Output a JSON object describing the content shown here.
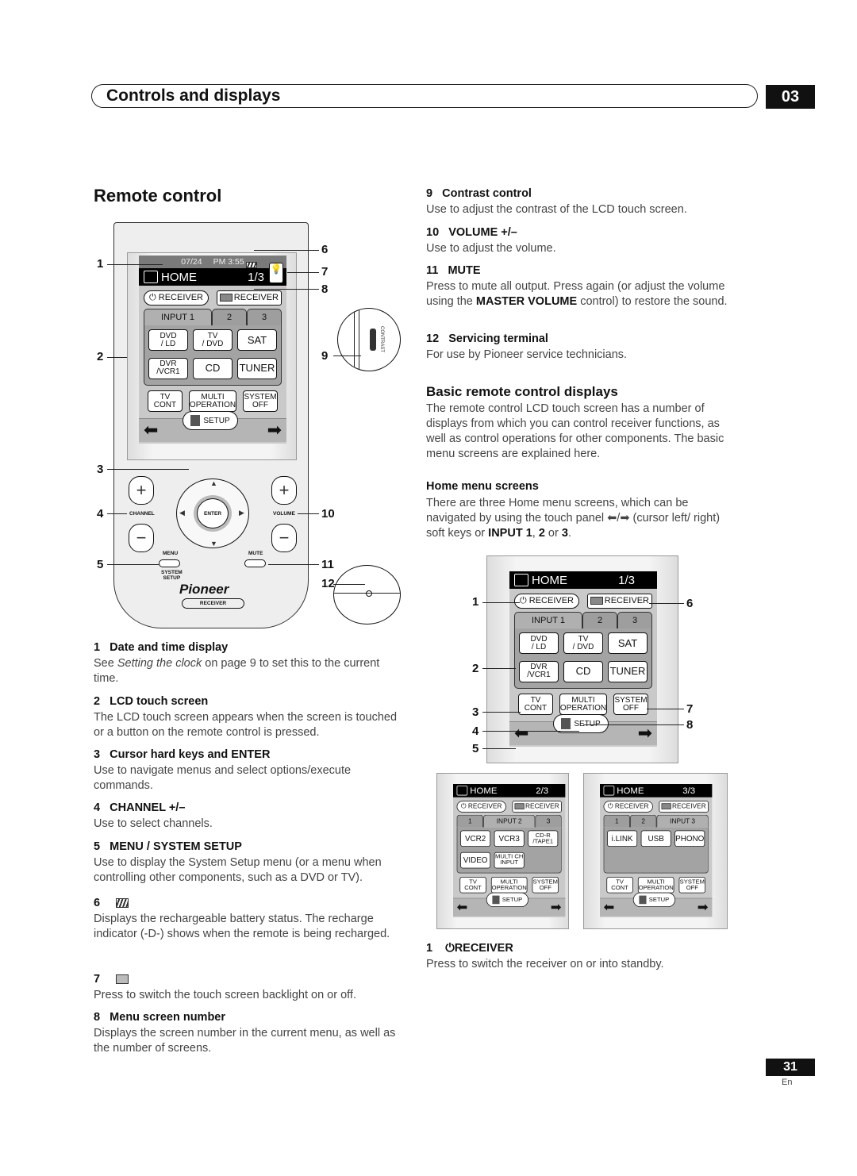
{
  "header": {
    "title": "Controls and displays",
    "chapter": "03"
  },
  "section_title": "Remote control",
  "remote": {
    "callouts": [
      "1",
      "2",
      "3",
      "4",
      "5",
      "6",
      "7",
      "8",
      "9",
      "10",
      "11",
      "12"
    ],
    "screen": {
      "date": "07/24",
      "time": "PM 3:55",
      "title": "HOME",
      "page": "1/3",
      "power": "RECEIVER",
      "av": "RECEIVER",
      "tabs": [
        {
          "label": "INPUT  1",
          "active": true
        },
        {
          "label": "2"
        },
        {
          "label": "3"
        }
      ],
      "sources": [
        "DVD\n/ LD",
        "TV\n/ DVD",
        "SAT",
        "DVR\n/VCR1",
        "CD",
        "TUNER"
      ],
      "bottom": [
        "TV\nCONT",
        "MULTI\nOPERATION",
        "SYSTEM\nOFF"
      ],
      "setup": "SETUP"
    },
    "contrast_label": "CONTRAST",
    "channel": "CHANNEL",
    "volume": "VOLUME",
    "enter": "ENTER",
    "menu": "MENU",
    "mute": "MUTE",
    "system_setup": "SYSTEM\nSETUP",
    "brand": "Pioneer",
    "model": "RECEIVER",
    "plus": "+",
    "minus": "−"
  },
  "left_items": [
    {
      "n": "1",
      "title": "Date and time display",
      "body_pre": "See ",
      "body_em": "Setting the clock",
      "body_post": " on page 9 to set this to the current time."
    },
    {
      "n": "2",
      "title": "LCD touch screen",
      "body": "The LCD touch screen appears when the screen is touched or a button on the remote control is pressed."
    },
    {
      "n": "3",
      "title": "Cursor hard keys and ENTER",
      "body": "Use to navigate menus and select options/execute commands."
    },
    {
      "n": "4",
      "title": "CHANNEL  +/–",
      "body": "Use to select channels."
    },
    {
      "n": "5",
      "title": "MENU / SYSTEM SETUP",
      "body": "Use to display the System Setup menu (or a menu when controlling other components, such as a DVD or TV)."
    },
    {
      "n": "6",
      "icon": "battery-icon",
      "body_pre": "Displays the rechargeable battery status. The recharge indicator (",
      "body_post": ") shows when the remote is being recharged."
    },
    {
      "n": "7",
      "icon": "backlight-bulb-icon",
      "body": "Press to switch the touch screen backlight on or off."
    },
    {
      "n": "8",
      "title": "Menu screen number",
      "body": "Displays the screen number in the current menu, as well as the number of screens."
    }
  ],
  "right_items": [
    {
      "n": "9",
      "title": "Contrast control",
      "body": "Use to adjust the contrast of the LCD touch screen."
    },
    {
      "n": "10",
      "title": "VOLUME +/–",
      "body": "Use to adjust the volume."
    },
    {
      "n": "11",
      "title": "MUTE",
      "body_pre": "Press to mute all output. Press again (or adjust the volume using the ",
      "body_b": "MASTER VOLUME",
      "body_post": " control) to restore the sound."
    },
    {
      "n": "12",
      "title": "Servicing terminal",
      "body": "For use by Pioneer service technicians."
    }
  ],
  "basic": {
    "title": "Basic remote control displays",
    "body": "The remote control LCD touch screen has a number of displays from which you can control receiver functions, as well as control operations for other components. The basic menu screens are explained here."
  },
  "home_menu": {
    "title": "Home menu screens",
    "body_pre": "There are three Home menu screens, which can be navigated by using the touch panel ",
    "body_mid": " (cursor left/ right) soft keys or ",
    "b1": "INPUT 1",
    "c1": ", ",
    "b2": "2",
    "c2": " or ",
    "b3": "3",
    "end": "."
  },
  "screens": [
    {
      "title": "HOME",
      "page": "1/3",
      "power": "RECEIVER",
      "av": "RECEIVER",
      "tabs": [
        {
          "label": "INPUT  1",
          "active": true
        },
        {
          "label": "2"
        },
        {
          "label": "3"
        }
      ],
      "sources": [
        "DVD\n/ LD",
        "TV\n/ DVD",
        "SAT",
        "DVR\n/VCR1",
        "CD",
        "TUNER"
      ],
      "bottom": [
        "TV\nCONT",
        "MULTI\nOPERATION",
        "SYSTEM\nOFF"
      ],
      "setup": "SETUP"
    },
    {
      "title": "HOME",
      "page": "2/3",
      "power": "RECEIVER",
      "av": "RECEIVER",
      "tabs": [
        {
          "label": "1"
        },
        {
          "label": "INPUT  2",
          "active": true
        },
        {
          "label": "3"
        }
      ],
      "sources": [
        "VCR2",
        "VCR3",
        "CD-R\n/TAPE1",
        "VIDEO",
        "MULTI CH\nINPUT"
      ],
      "bottom": [
        "TV\nCONT",
        "MULTI\nOPERATION",
        "SYSTEM\nOFF"
      ],
      "setup": "SETUP"
    },
    {
      "title": "HOME",
      "page": "3/3",
      "power": "RECEIVER",
      "av": "RECEIVER",
      "tabs": [
        {
          "label": "1"
        },
        {
          "label": "2"
        },
        {
          "label": "INPUT  3",
          "active": true
        }
      ],
      "sources": [
        "i.LINK",
        "USB",
        "PHONO"
      ],
      "bottom": [
        "TV\nCONT",
        "MULTI\nOPERATION",
        "SYSTEM\nOFF"
      ],
      "setup": "SETUP"
    }
  ],
  "screen_callouts": [
    "1",
    "2",
    "3",
    "4",
    "5",
    "6",
    "7",
    "8"
  ],
  "receiver_item": {
    "n": "1",
    "title": "RECEIVER",
    "body": "Press to switch the receiver on or into standby."
  },
  "footer": {
    "page": "31",
    "lang": "En"
  }
}
